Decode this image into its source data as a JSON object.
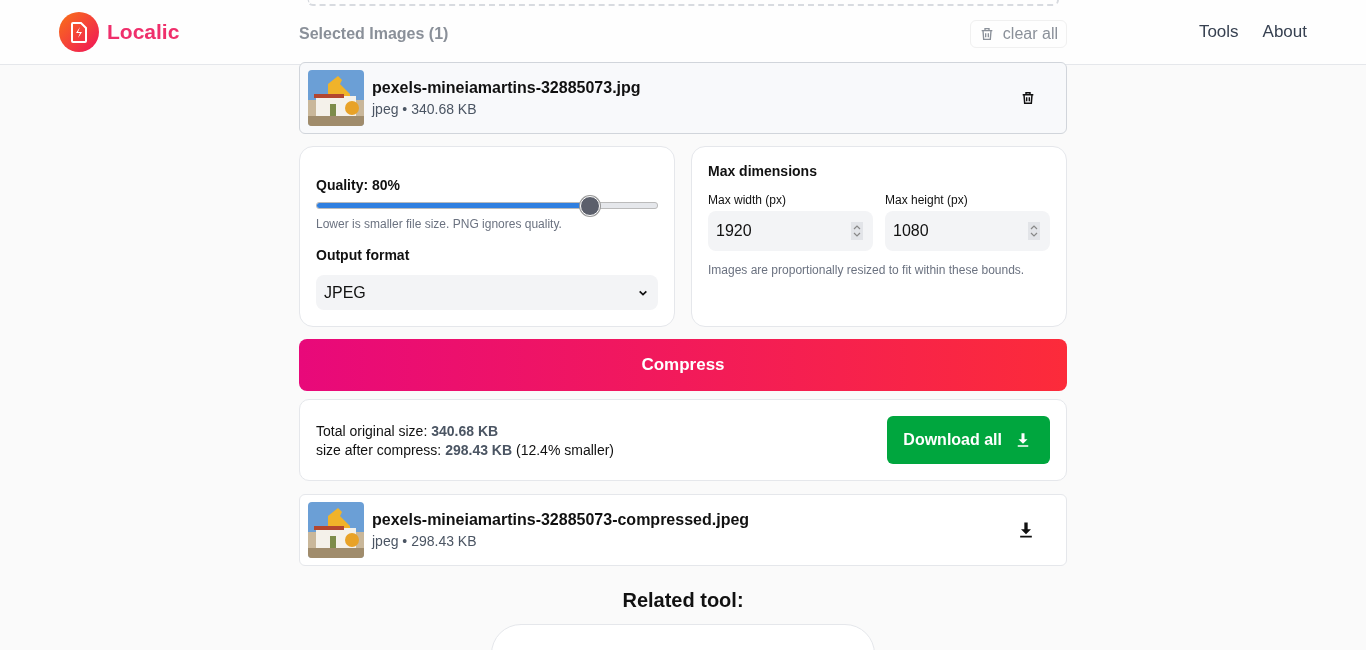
{
  "header": {
    "brand": "Localic",
    "nav": [
      {
        "label": "Tools"
      },
      {
        "label": "About"
      }
    ]
  },
  "selected": {
    "title": "Selected Images (1)",
    "clear_label": "clear all",
    "files": [
      {
        "name": "pexels-mineiamartins-32885073.jpg",
        "meta": "jpeg • 340.68 KB"
      }
    ]
  },
  "settings": {
    "quality_label": "Quality: 80%",
    "quality": {
      "level": 0.8
    },
    "quality_hint": "Lower is smaller file size. PNG ignores quality.",
    "format_label": "Output format",
    "format_value": "JPEG",
    "dims_title": "Max dimensions",
    "width_label": "Max width (px)",
    "width_value": "1920",
    "height_label": "Max height (px)",
    "height_value": "1080",
    "dims_hint": "Images are proportionally resized to fit within these bounds."
  },
  "compress_label": "Compress",
  "summary": {
    "original_line": "Total original size: **340.68 KB**",
    "after_line": "size after compress: **298.43 KB** (12.4% smaller)",
    "download_label": "Download all"
  },
  "results": [
    {
      "name": "pexels-mineiamartins-32885073-compressed.jpeg",
      "meta": "jpeg • 298.43 KB"
    }
  ],
  "related": {
    "title": "Related tool:"
  }
}
